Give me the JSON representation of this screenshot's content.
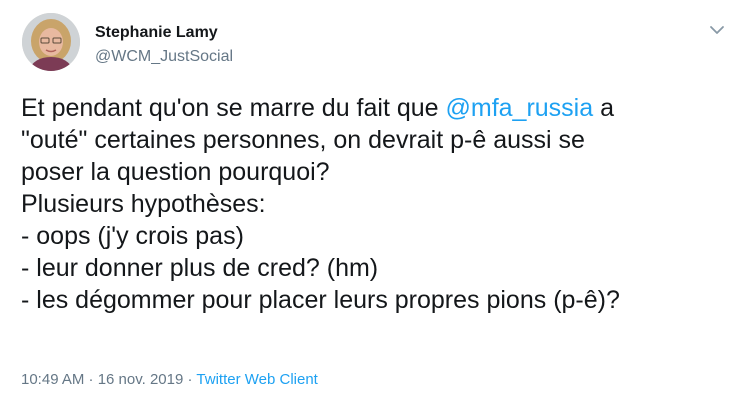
{
  "author": {
    "name": "Stephanie Lamy",
    "handle": "@WCM_JustSocial"
  },
  "tweet": {
    "line1_before": "Et pendant qu'on se marre du fait que ",
    "mention": "@mfa_russia",
    "line1_after": " a",
    "line2": "\"outé\" certaines personnes, on devrait p-ê aussi se",
    "line3": "poser la question pourquoi?",
    "line4": "Plusieurs hypothèses:",
    "line5": "- oops (j'y crois pas)",
    "line6": "- leur donner plus de cred? (hm)",
    "line7": "- les dégommer pour placer leurs propres pions (p-ê)?"
  },
  "footer": {
    "timestamp": "10:49 AM · 16 nov. 2019",
    "separator": " · ",
    "client": "Twitter Web Client"
  },
  "icons": {
    "menu": "chevron-down-icon",
    "avatar": "profile-photo"
  },
  "colors": {
    "text": "#14171a",
    "secondary": "#657786",
    "link": "#1da1f2"
  }
}
